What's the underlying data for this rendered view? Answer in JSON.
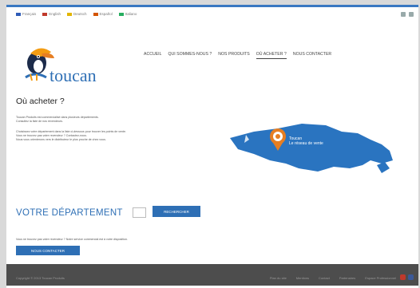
{
  "languages": [
    {
      "label": "Français",
      "color": "#2e5cb8"
    },
    {
      "label": "English",
      "color": "#c0392b"
    },
    {
      "label": "Deutsch",
      "color": "#e2b500"
    },
    {
      "label": "Español",
      "color": "#d35400"
    },
    {
      "label": "Italiano",
      "color": "#27ae60"
    }
  ],
  "brand": {
    "name": "toucan",
    "color": "#2e6fb5"
  },
  "nav": {
    "items": [
      "ACCUEIL",
      "QUI SOMMES-NOUS ?",
      "NOS PRODUITS",
      "OÙ ACHETER ?",
      "NOUS CONTACTER"
    ],
    "active_index": 3
  },
  "page": {
    "title": "Où acheter ?",
    "para1_line1": "Toucan Produits est commercialisé dans plusieurs départements.",
    "para1_line2": "Consultez la liste de nos revendeurs.",
    "para2_line1": "Choisissez votre département dans la liste ci-dessous pour trouver les points de vente.",
    "para2_line2": "Vous ne trouvez pas votre revendeur ? Contactez-nous.",
    "para2_line3": "Nous vous orienterons vers le distributeur le plus proche de chez vous."
  },
  "map": {
    "label_line1": "Toucan",
    "label_line2": "Le réseau de vente"
  },
  "department": {
    "title": "VOTRE DÉPARTEMENT",
    "button": "RECHERCHER"
  },
  "note": "Vous ne trouvez pas votre revendeur ? Notre service commercial est à votre disposition.",
  "contact_button": "NOUS CONTACTER",
  "footer": {
    "copyright": "Copyright © 2013 Toucan Produits",
    "links": [
      "Plan du site",
      "Mentions",
      "Contact",
      "Partenaires",
      "Espace Professionnel"
    ]
  },
  "social_colors": [
    "#c0392b",
    "#3b5998"
  ]
}
